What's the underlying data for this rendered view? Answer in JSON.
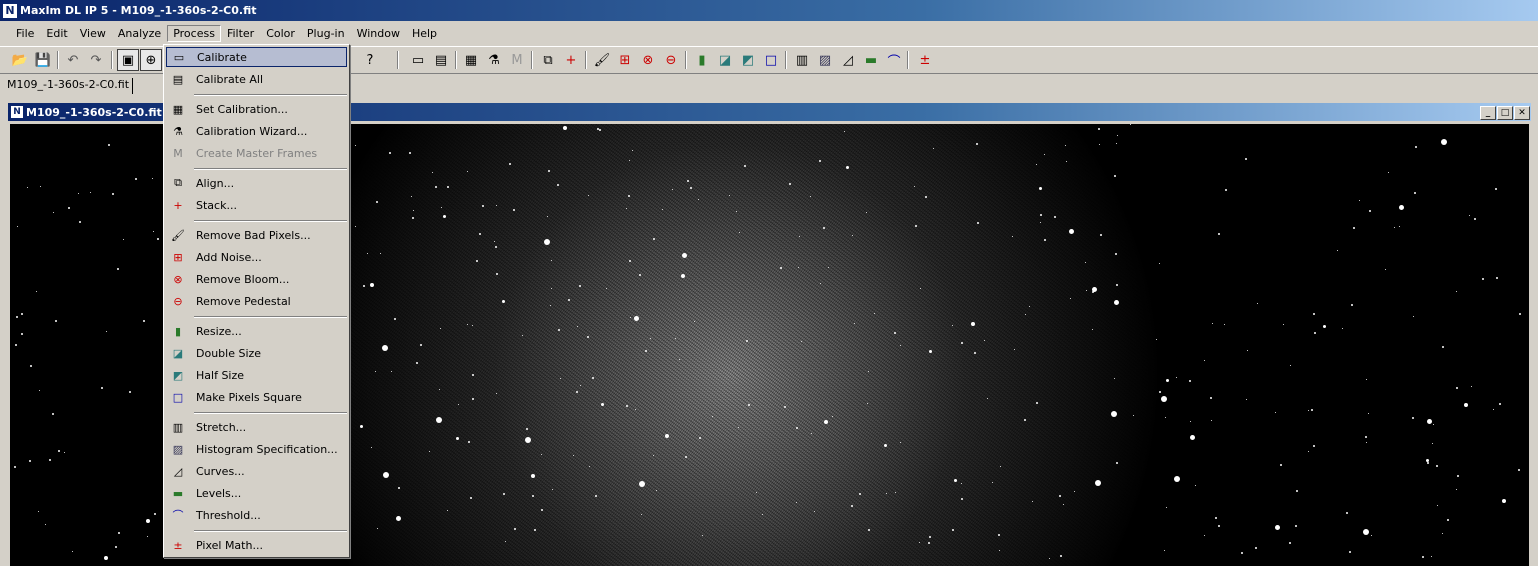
{
  "app": {
    "title": "MaxIm DL IP 5 - M109_-1-360s-2-C0.fit"
  },
  "menubar": [
    "File",
    "Edit",
    "View",
    "Analyze",
    "Process",
    "Filter",
    "Color",
    "Plug-in",
    "Window",
    "Help"
  ],
  "tab": {
    "label": "M109_-1-360s-2-C0.fit"
  },
  "document": {
    "title": "M109_-1-360s-2-C0.fit"
  },
  "process_menu": [
    {
      "label": "Calibrate",
      "icon": "calibrate-icon",
      "highlighted": true
    },
    {
      "label": "Calibrate All",
      "icon": "calibrate-all-icon"
    },
    {
      "label": "Set Calibration...",
      "icon": "set-calibration-icon"
    },
    {
      "label": "Calibration Wizard...",
      "icon": "calibration-wizard-icon"
    },
    {
      "label": "Create Master Frames",
      "icon": "master-frames-icon",
      "disabled": true
    },
    {
      "label": "Align...",
      "icon": "align-icon"
    },
    {
      "label": "Stack...",
      "icon": "stack-icon"
    },
    {
      "label": "Remove Bad Pixels...",
      "icon": "bad-pixels-icon"
    },
    {
      "label": "Add Noise...",
      "icon": "add-noise-icon"
    },
    {
      "label": "Remove Bloom...",
      "icon": "remove-bloom-icon"
    },
    {
      "label": "Remove Pedestal",
      "icon": "remove-pedestal-icon"
    },
    {
      "label": "Resize...",
      "icon": "resize-icon"
    },
    {
      "label": "Double Size",
      "icon": "double-size-icon"
    },
    {
      "label": "Half Size",
      "icon": "half-size-icon"
    },
    {
      "label": "Make Pixels Square",
      "icon": "pixels-square-icon"
    },
    {
      "label": "Stretch...",
      "icon": "stretch-icon"
    },
    {
      "label": "Histogram Specification...",
      "icon": "histogram-icon"
    },
    {
      "label": "Curves...",
      "icon": "curves-icon"
    },
    {
      "label": "Levels...",
      "icon": "levels-icon"
    },
    {
      "label": "Threshold...",
      "icon": "threshold-icon"
    },
    {
      "label": "Pixel Math...",
      "icon": "pixel-math-icon"
    }
  ]
}
